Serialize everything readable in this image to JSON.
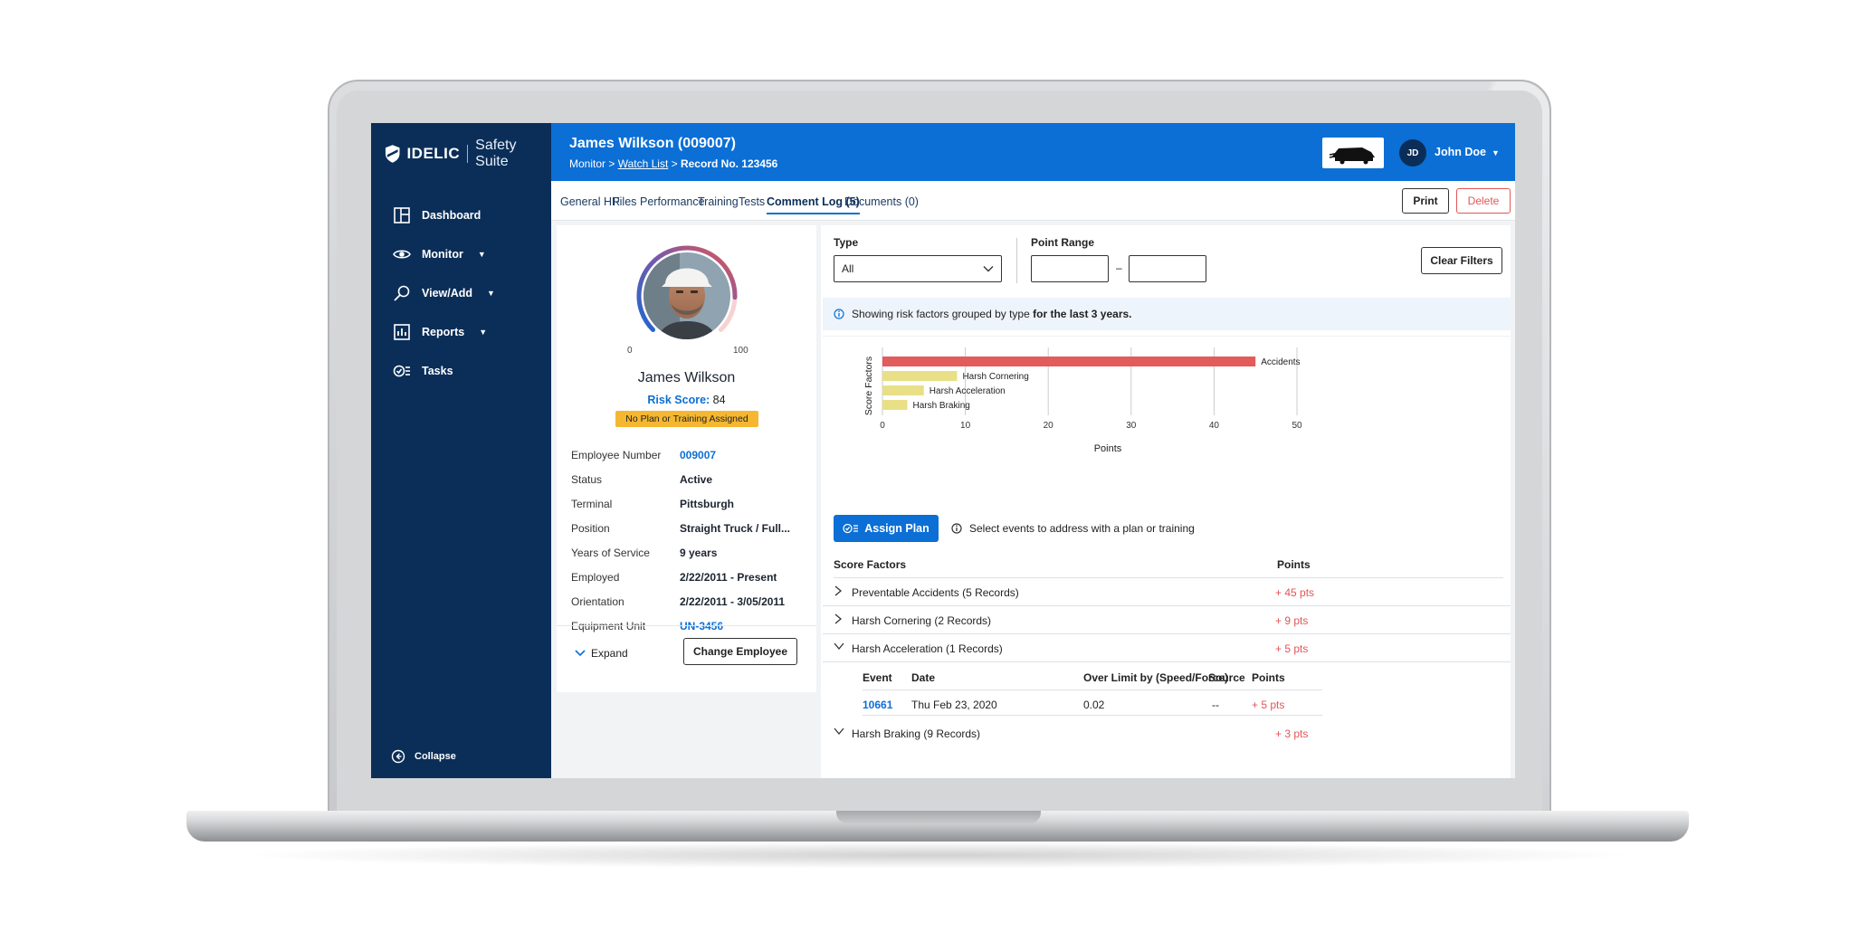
{
  "sidebar": {
    "brand": "IDELIC",
    "suite": "Safety Suite",
    "items": [
      {
        "label": "Dashboard",
        "icon": "dashboard-icon",
        "caret": false
      },
      {
        "label": "Monitor",
        "icon": "eye-icon",
        "caret": true
      },
      {
        "label": "View/Add",
        "icon": "search-icon",
        "caret": true
      },
      {
        "label": "Reports",
        "icon": "bar-chart-icon",
        "caret": true
      },
      {
        "label": "Tasks",
        "icon": "tasks-icon",
        "caret": false
      }
    ],
    "collapse": "Collapse"
  },
  "header": {
    "title": "James Wilkson (009007)",
    "breadcrumb": [
      "Monitor",
      "Watch List",
      "Record No. 123456"
    ],
    "user_initials": "JD",
    "user_name": "John Doe"
  },
  "tabs": [
    {
      "label": "General HR"
    },
    {
      "label": "Files"
    },
    {
      "label": "Performance"
    },
    {
      "label": "Training"
    },
    {
      "label": "Tests"
    },
    {
      "label": "Comment Log (5)",
      "active": true
    },
    {
      "label": "Documents (0)"
    }
  ],
  "actions": {
    "print": "Print",
    "delete": "Delete"
  },
  "profile": {
    "name": "James Wilkson",
    "risk_label": "Risk Score:",
    "risk_score": "84",
    "gauge_min": "0",
    "gauge_max": "100",
    "gauge_fraction": 0.84,
    "badge": "No Plan or Training Assigned",
    "fields": [
      {
        "k": "Employee Number",
        "v": "009007",
        "link": true
      },
      {
        "k": "Status",
        "v": "Active"
      },
      {
        "k": "Terminal",
        "v": "Pittsburgh"
      },
      {
        "k": "Position",
        "v": "Straight Truck / Full..."
      },
      {
        "k": "Years of Service",
        "v": "9 years"
      },
      {
        "k": "Employed",
        "v": "2/22/2011 - Present"
      },
      {
        "k": "Orientation",
        "v": "2/22/2011 - 3/05/2011"
      },
      {
        "k": "Equipment Unit",
        "v": "UN-3456",
        "link": true
      }
    ],
    "expand": "Expand",
    "change_employee": "Change Employee"
  },
  "filters": {
    "type_label": "Type",
    "type_value": "All",
    "range_label": "Point Range",
    "range_sep": "–",
    "clear": "Clear Filters"
  },
  "info": {
    "text": "Showing risk factors grouped by type",
    "bold": "for the last 3 years."
  },
  "chart_data": {
    "type": "bar",
    "orientation": "horizontal",
    "categories": [
      "Accidents",
      "Harsh Cornering",
      "Harsh Acceleration",
      "Harsh Braking"
    ],
    "values": [
      45,
      9,
      5,
      3
    ],
    "colors": [
      "#e25c5c",
      "#e9df86",
      "#e9df86",
      "#e9df86"
    ],
    "xlabel": "Points",
    "ylabel": "Score Factors",
    "xlim": [
      0,
      50
    ],
    "xticks": [
      0,
      10,
      20,
      30,
      40,
      50
    ],
    "grid": true
  },
  "assign": {
    "button": "Assign Plan",
    "hint": "Select events to address with a plan or training"
  },
  "score_table": {
    "headers": {
      "factor": "Score Factors",
      "points": "Points"
    },
    "rows": [
      {
        "label": "Preventable Accidents (5 Records)",
        "pts": "+ 45 pts",
        "expanded": false
      },
      {
        "label": "Harsh Cornering (2 Records)",
        "pts": "+ 9 pts",
        "expanded": false
      },
      {
        "label": "Harsh Acceleration (1 Records)",
        "pts": "+ 5 pts",
        "expanded": true
      },
      {
        "label": "Harsh Braking (9 Records)",
        "pts": "+ 3 pts",
        "expanded": true
      }
    ],
    "sub_headers": [
      "Event",
      "Date",
      "Over Limit by (Speed/Force)",
      "Source",
      "Points"
    ],
    "sub_rows": [
      {
        "event": "10661",
        "date": "Thu Feb 23, 2020",
        "over": "0.02",
        "source": "--",
        "pts": "+ 5 pts"
      }
    ]
  },
  "colors": {
    "sidebar": "#0b2e58",
    "topbar": "#0b6fd6",
    "accent": "#0b6fd6",
    "danger": "#e25656",
    "badge": "#f5b731"
  }
}
